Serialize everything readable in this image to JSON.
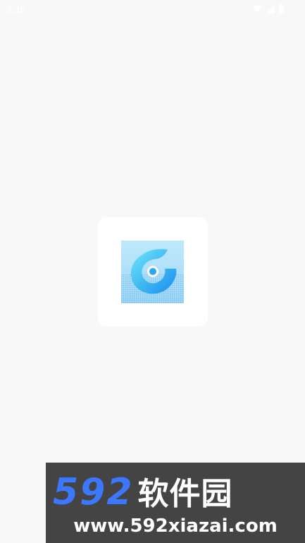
{
  "status_bar": {
    "time": "3:46",
    "icons": [
      "wifi-icon",
      "signal-icon",
      "battery-icon"
    ]
  },
  "splash": {
    "logo_icon": "app-logo-icon",
    "colors": {
      "background": "#f8f8f8",
      "card": "#ffffff",
      "logo_light": "#6ee3f7",
      "logo_dark": "#1a8ef0"
    }
  },
  "watermark": {
    "brand_number": "592",
    "brand_text": "软件园",
    "url": "www.592xiazai.com",
    "colors": {
      "background": "#444444",
      "number": "#3c78ff",
      "text": "#ffffff"
    }
  }
}
